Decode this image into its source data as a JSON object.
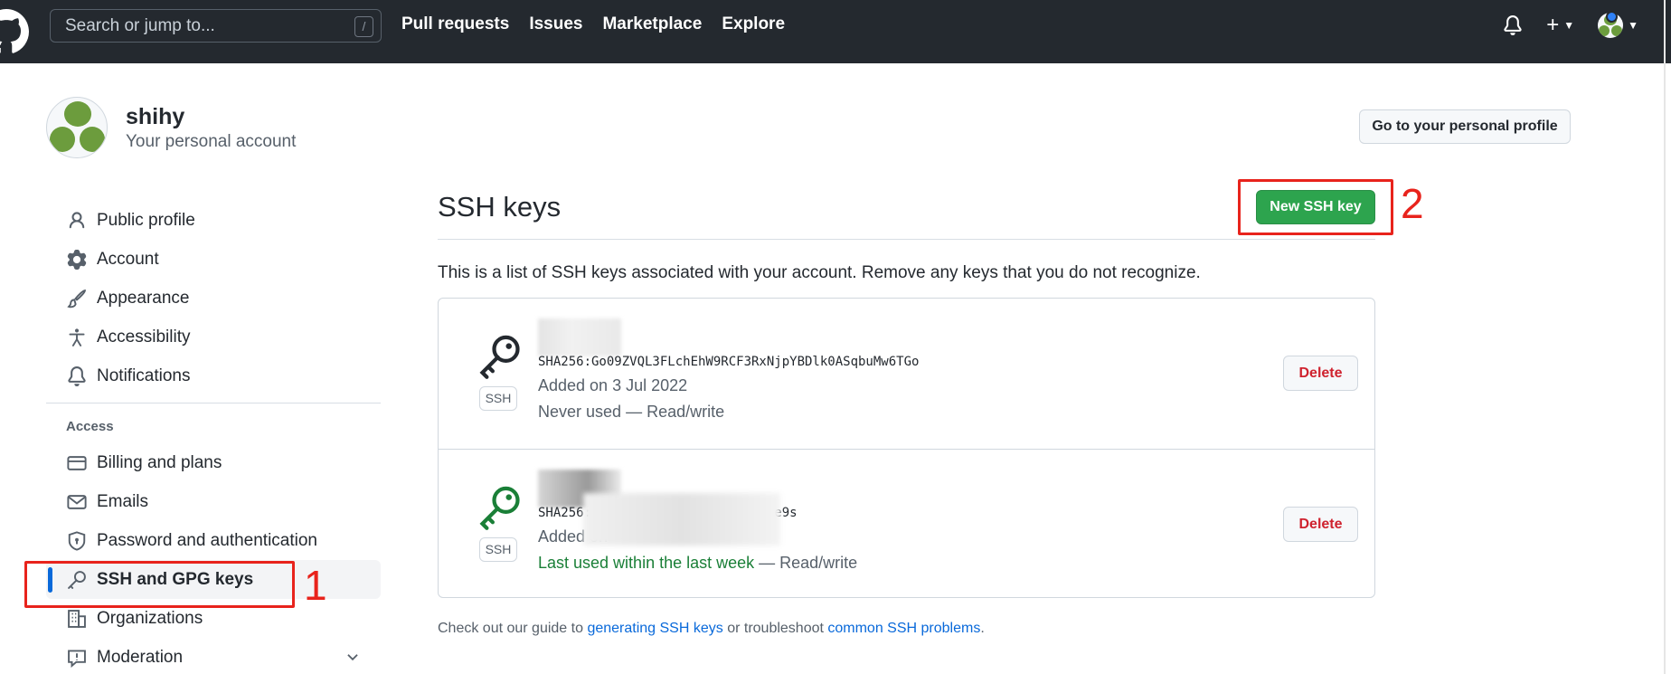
{
  "header": {
    "search_placeholder": "Search or jump to...",
    "search_shortcut": "/",
    "nav": [
      "Pull requests",
      "Issues",
      "Marketplace",
      "Explore"
    ]
  },
  "profile": {
    "username": "shihy",
    "account_type": "Your personal account",
    "profile_button": "Go to your personal profile"
  },
  "sidebar": {
    "items": [
      {
        "label": "Public profile",
        "icon": "person-icon"
      },
      {
        "label": "Account",
        "icon": "gear-icon"
      },
      {
        "label": "Appearance",
        "icon": "paintbrush-icon"
      },
      {
        "label": "Accessibility",
        "icon": "accessibility-icon"
      },
      {
        "label": "Notifications",
        "icon": "bell-icon"
      }
    ],
    "access_heading": "Access",
    "access_items": [
      {
        "label": "Billing and plans",
        "icon": "credit-card-icon"
      },
      {
        "label": "Emails",
        "icon": "mail-icon"
      },
      {
        "label": "Password and authentication",
        "icon": "shield-lock-icon"
      },
      {
        "label": "SSH and GPG keys",
        "icon": "key-icon",
        "selected": true
      },
      {
        "label": "Organizations",
        "icon": "organization-icon"
      },
      {
        "label": "Moderation",
        "icon": "report-icon"
      }
    ]
  },
  "annotations": {
    "one": "1",
    "two": "2"
  },
  "main": {
    "title": "SSH keys",
    "new_key_button": "New SSH key",
    "intro": "This is a list of SSH keys associated with your account. Remove any keys that you do not recognize.",
    "keys": [
      {
        "type_label": "SSH",
        "fingerprint": "SHA256:Go09ZVQL3FLchEhW9RCF3RxNjpYBDlk0ASqbuMw6TGo",
        "added": "Added on 3 Jul 2022",
        "usage": "Never used",
        "access": " — Read/write",
        "delete_label": "Delete",
        "icon_color": "#24292f"
      },
      {
        "type_label": "SSH",
        "fingerprint": "SHA256:                  uf6lIShE0eTlhfiAH1J/KKee9s",
        "added": "Added on",
        "usage": "Last used within the last week",
        "access": " — Read/write",
        "delete_label": "Delete",
        "icon_color": "#1a7f37"
      }
    ],
    "footer": {
      "prefix": "Check out our guide to ",
      "link1": "generating SSH keys",
      "middle": " or troubleshoot ",
      "link2": "common SSH problems",
      "suffix": "."
    }
  },
  "colors": {
    "header_bg": "#24292f",
    "primary_green": "#2da44e",
    "danger_red": "#cf222e",
    "link_blue": "#0969da",
    "annotation_red": "#e8231c"
  }
}
